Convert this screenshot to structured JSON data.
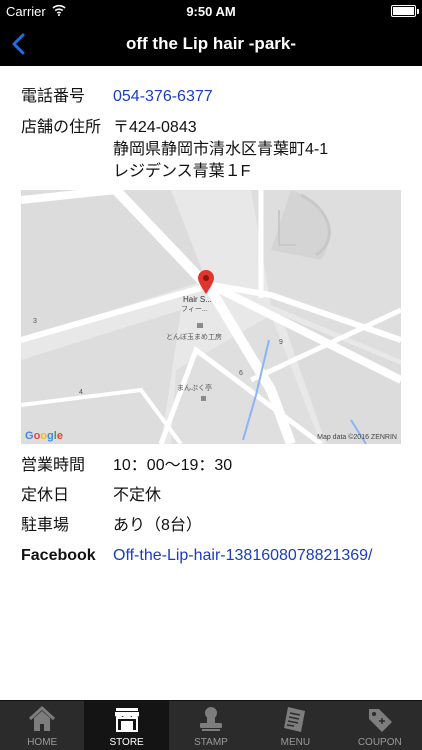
{
  "status_bar": {
    "carrier": "Carrier",
    "time": "9:50 AM"
  },
  "nav": {
    "title": "off the Lip hair -park-",
    "back_icon": "chevron-left-icon",
    "accent_color": "#1e6ee8"
  },
  "info": {
    "phone_label": "電話番号",
    "phone_value": "054-376-6377",
    "address_label": "店舗の住所",
    "address_lines": [
      "〒424-0843",
      "静岡県静岡市清水区青葉町4-1",
      "レジデンス青葉１F"
    ],
    "hours_label": "営業時間",
    "hours_value": "10：00〜19：30",
    "closed_label": "定休日",
    "closed_value": "不定休",
    "parking_label": "駐車場",
    "parking_value": "あり（8台）",
    "facebook_label": "Facebook",
    "facebook_value": "Off-the-Lip-hair-1381608078821369/"
  },
  "map": {
    "place_label": "Hair S...",
    "place_sub": "フィー...",
    "shop_1": "とんぼ玉まめ工房",
    "shop_2": "まんぷく亭",
    "block_numbers": [
      "3",
      "4",
      "6",
      "9"
    ],
    "google_logo": "Google",
    "attribution": "Map data ©2016 ZENRIN"
  },
  "tabs": [
    {
      "label": "HOME",
      "icon": "house-icon",
      "selected": false
    },
    {
      "label": "STORE",
      "icon": "storefront-icon",
      "selected": true
    },
    {
      "label": "STAMP",
      "icon": "stamp-icon",
      "selected": false
    },
    {
      "label": "MENU",
      "icon": "menu-book-icon",
      "selected": false
    },
    {
      "label": "COUPON",
      "icon": "coupon-tag-icon",
      "selected": false
    }
  ],
  "colors": {
    "link": "#1a3cc4",
    "bar_background": "#000000",
    "tab_background": "#2b2b2b",
    "map_pin": "#e2342d"
  }
}
